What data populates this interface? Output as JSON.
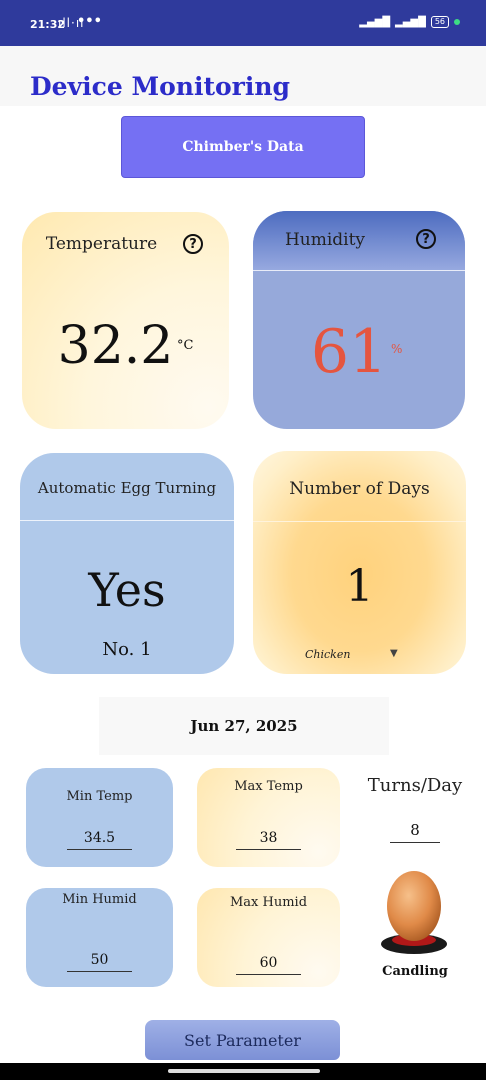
{
  "status_bar": {
    "time": "21:32",
    "notif": "ıll·ıı",
    "dots": "•••",
    "battery": "56"
  },
  "header": {
    "title": "Device Monitoring"
  },
  "data_button": {
    "label": "Chimber's Data"
  },
  "temperature": {
    "label": "Temperature",
    "value": "32.2",
    "unit": "°C",
    "help": "?"
  },
  "humidity": {
    "label": "Humidity",
    "value": "61",
    "unit": "%",
    "help": "?"
  },
  "egg_turning": {
    "label": "Automatic Egg Turning",
    "value": "Yes",
    "sub": "No. 1"
  },
  "days": {
    "label": "Number of Days",
    "value": "1",
    "species": "Chicken",
    "dropdown": "▼"
  },
  "date": "Jun 27, 2025",
  "params": {
    "min_temp": {
      "label": "Min Temp",
      "value": "34.5"
    },
    "max_temp": {
      "label": "Max Temp",
      "value": "38"
    },
    "min_humid": {
      "label": "Min Humid",
      "value": "50"
    },
    "max_humid": {
      "label": "Max Humid",
      "value": "60"
    },
    "turns": {
      "label": "Turns/Day",
      "value": "8"
    }
  },
  "candling": {
    "label": "Candling"
  },
  "set_button": {
    "label": "Set Parameter"
  },
  "colors": {
    "title": "#2c2cc9",
    "humidity_value": "#e5553f",
    "status_bar": "#2f3a9c",
    "data_button": "#7570f3"
  }
}
